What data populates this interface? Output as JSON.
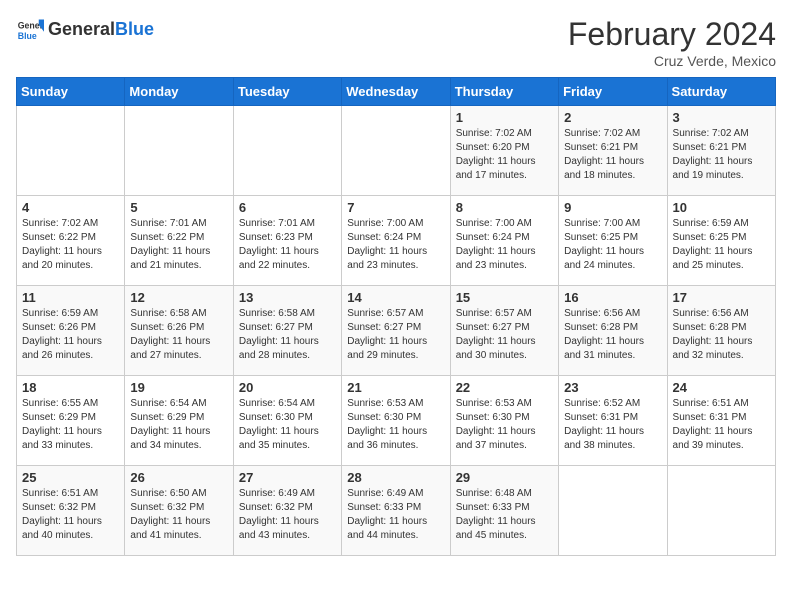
{
  "logo": {
    "general": "General",
    "blue": "Blue"
  },
  "title": {
    "month_year": "February 2024",
    "location": "Cruz Verde, Mexico"
  },
  "weekdays": [
    "Sunday",
    "Monday",
    "Tuesday",
    "Wednesday",
    "Thursday",
    "Friday",
    "Saturday"
  ],
  "weeks": [
    [
      {
        "day": "",
        "info": ""
      },
      {
        "day": "",
        "info": ""
      },
      {
        "day": "",
        "info": ""
      },
      {
        "day": "",
        "info": ""
      },
      {
        "day": "1",
        "info": "Sunrise: 7:02 AM\nSunset: 6:20 PM\nDaylight: 11 hours and 17 minutes."
      },
      {
        "day": "2",
        "info": "Sunrise: 7:02 AM\nSunset: 6:21 PM\nDaylight: 11 hours and 18 minutes."
      },
      {
        "day": "3",
        "info": "Sunrise: 7:02 AM\nSunset: 6:21 PM\nDaylight: 11 hours and 19 minutes."
      }
    ],
    [
      {
        "day": "4",
        "info": "Sunrise: 7:02 AM\nSunset: 6:22 PM\nDaylight: 11 hours and 20 minutes."
      },
      {
        "day": "5",
        "info": "Sunrise: 7:01 AM\nSunset: 6:22 PM\nDaylight: 11 hours and 21 minutes."
      },
      {
        "day": "6",
        "info": "Sunrise: 7:01 AM\nSunset: 6:23 PM\nDaylight: 11 hours and 22 minutes."
      },
      {
        "day": "7",
        "info": "Sunrise: 7:00 AM\nSunset: 6:24 PM\nDaylight: 11 hours and 23 minutes."
      },
      {
        "day": "8",
        "info": "Sunrise: 7:00 AM\nSunset: 6:24 PM\nDaylight: 11 hours and 23 minutes."
      },
      {
        "day": "9",
        "info": "Sunrise: 7:00 AM\nSunset: 6:25 PM\nDaylight: 11 hours and 24 minutes."
      },
      {
        "day": "10",
        "info": "Sunrise: 6:59 AM\nSunset: 6:25 PM\nDaylight: 11 hours and 25 minutes."
      }
    ],
    [
      {
        "day": "11",
        "info": "Sunrise: 6:59 AM\nSunset: 6:26 PM\nDaylight: 11 hours and 26 minutes."
      },
      {
        "day": "12",
        "info": "Sunrise: 6:58 AM\nSunset: 6:26 PM\nDaylight: 11 hours and 27 minutes."
      },
      {
        "day": "13",
        "info": "Sunrise: 6:58 AM\nSunset: 6:27 PM\nDaylight: 11 hours and 28 minutes."
      },
      {
        "day": "14",
        "info": "Sunrise: 6:57 AM\nSunset: 6:27 PM\nDaylight: 11 hours and 29 minutes."
      },
      {
        "day": "15",
        "info": "Sunrise: 6:57 AM\nSunset: 6:27 PM\nDaylight: 11 hours and 30 minutes."
      },
      {
        "day": "16",
        "info": "Sunrise: 6:56 AM\nSunset: 6:28 PM\nDaylight: 11 hours and 31 minutes."
      },
      {
        "day": "17",
        "info": "Sunrise: 6:56 AM\nSunset: 6:28 PM\nDaylight: 11 hours and 32 minutes."
      }
    ],
    [
      {
        "day": "18",
        "info": "Sunrise: 6:55 AM\nSunset: 6:29 PM\nDaylight: 11 hours and 33 minutes."
      },
      {
        "day": "19",
        "info": "Sunrise: 6:54 AM\nSunset: 6:29 PM\nDaylight: 11 hours and 34 minutes."
      },
      {
        "day": "20",
        "info": "Sunrise: 6:54 AM\nSunset: 6:30 PM\nDaylight: 11 hours and 35 minutes."
      },
      {
        "day": "21",
        "info": "Sunrise: 6:53 AM\nSunset: 6:30 PM\nDaylight: 11 hours and 36 minutes."
      },
      {
        "day": "22",
        "info": "Sunrise: 6:53 AM\nSunset: 6:30 PM\nDaylight: 11 hours and 37 minutes."
      },
      {
        "day": "23",
        "info": "Sunrise: 6:52 AM\nSunset: 6:31 PM\nDaylight: 11 hours and 38 minutes."
      },
      {
        "day": "24",
        "info": "Sunrise: 6:51 AM\nSunset: 6:31 PM\nDaylight: 11 hours and 39 minutes."
      }
    ],
    [
      {
        "day": "25",
        "info": "Sunrise: 6:51 AM\nSunset: 6:32 PM\nDaylight: 11 hours and 40 minutes."
      },
      {
        "day": "26",
        "info": "Sunrise: 6:50 AM\nSunset: 6:32 PM\nDaylight: 11 hours and 41 minutes."
      },
      {
        "day": "27",
        "info": "Sunrise: 6:49 AM\nSunset: 6:32 PM\nDaylight: 11 hours and 43 minutes."
      },
      {
        "day": "28",
        "info": "Sunrise: 6:49 AM\nSunset: 6:33 PM\nDaylight: 11 hours and 44 minutes."
      },
      {
        "day": "29",
        "info": "Sunrise: 6:48 AM\nSunset: 6:33 PM\nDaylight: 11 hours and 45 minutes."
      },
      {
        "day": "",
        "info": ""
      },
      {
        "day": "",
        "info": ""
      }
    ]
  ]
}
